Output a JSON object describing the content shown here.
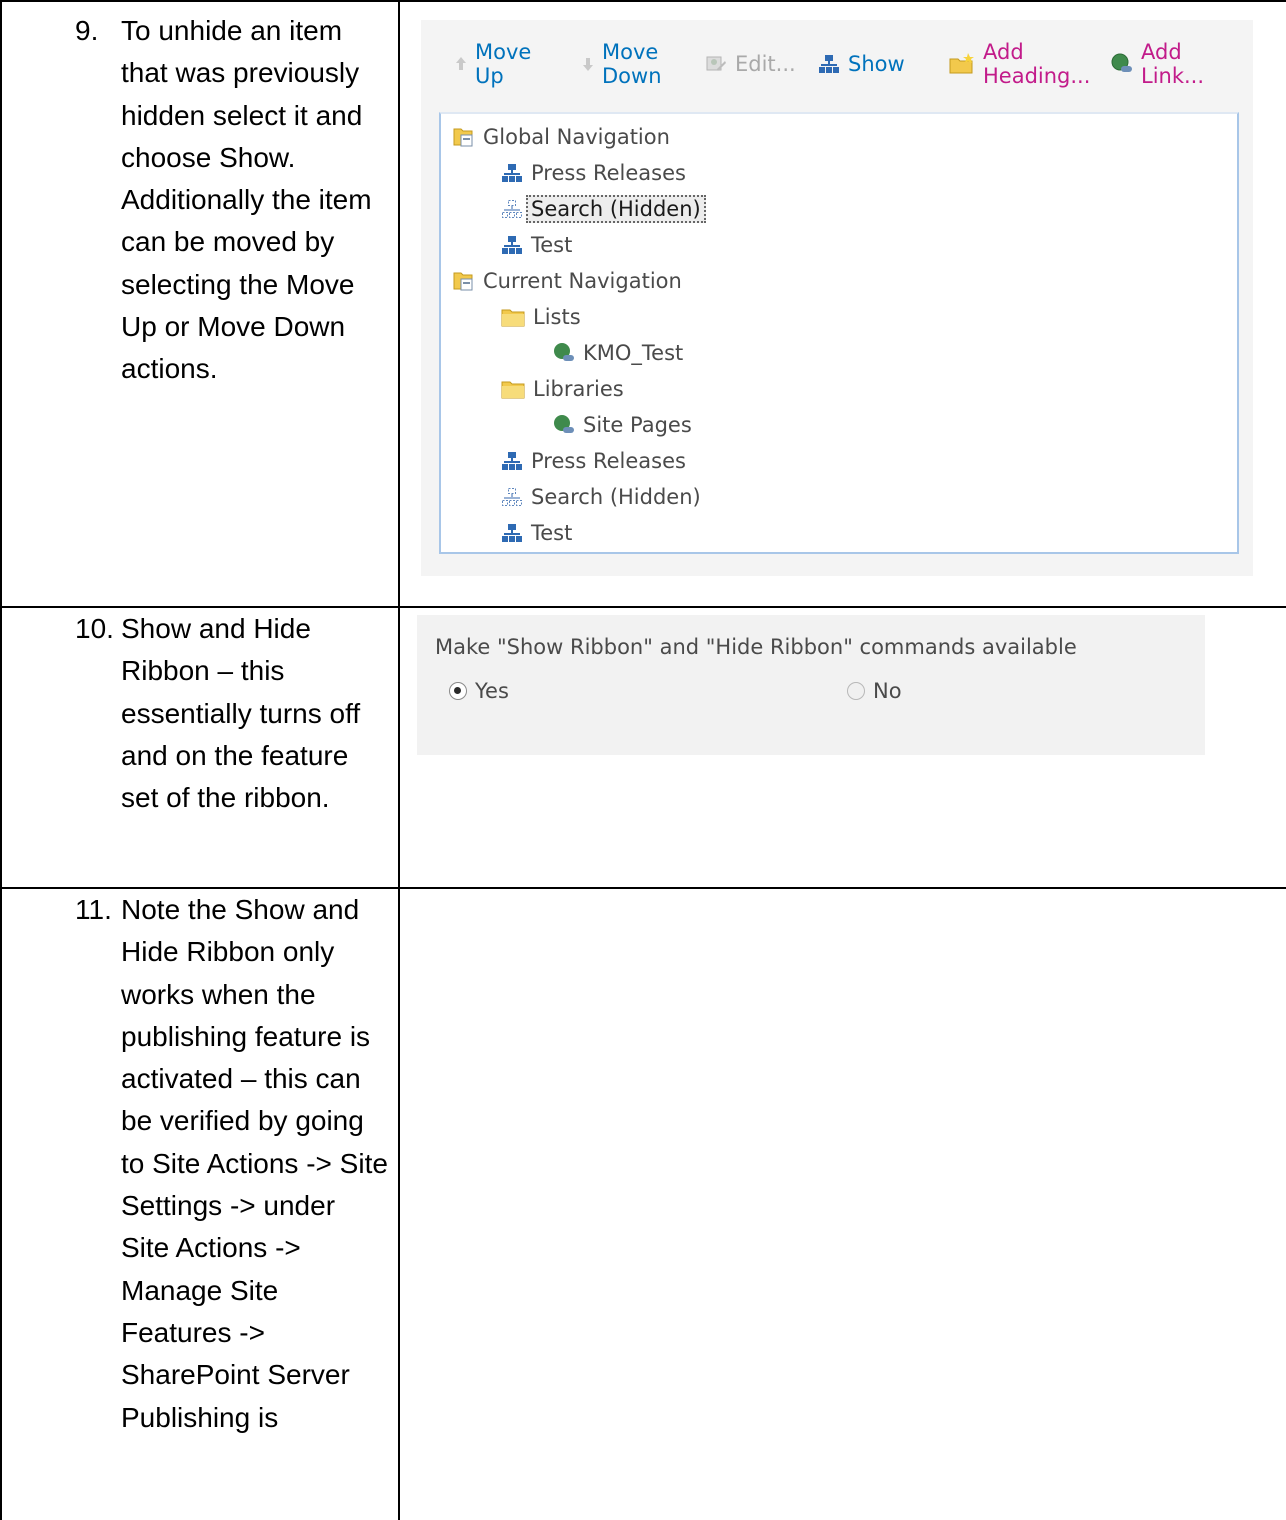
{
  "steps": [
    {
      "number": "9.",
      "text": "To unhide an item that was previously hidden select it and choose Show. Additionally the item can be moved by selecting the Move Up or Move Down actions."
    },
    {
      "number": "10.",
      "text": "Show and Hide Ribbon – this essentially turns off and on the feature set of the ribbon."
    },
    {
      "number": "11.",
      "text": "Note the Show and Hide Ribbon only works when the publishing feature is activated – this can be verified by going to Site Actions -> Site Settings -> under Site Actions -> Manage Site Features -> SharePoint Server Publishing is"
    }
  ],
  "navigation_editor": {
    "toolbar": {
      "move_up": "Move\nUp",
      "move_down": "Move\nDown",
      "edit": "Edit...",
      "show": "Show",
      "add_heading": "Add\nHeading...",
      "add_link": "Add\nLink..."
    },
    "tree": {
      "global_navigation": "Global Navigation",
      "global_press_releases": "Press Releases",
      "global_search": "Search (Hidden)",
      "global_test": "Test",
      "current_navigation": "Current Navigation",
      "lists": "Lists",
      "kmo_test": "KMO_Test",
      "libraries": "Libraries",
      "site_pages": "Site Pages",
      "current_press_releases": "Press Releases",
      "current_search": "Search (Hidden)",
      "current_test": "Test"
    },
    "selected_item": "Search (Hidden)"
  },
  "ribbon_setting": {
    "question": "Make \"Show Ribbon\" and \"Hide Ribbon\" commands available",
    "yes_label": "Yes",
    "no_label": "No",
    "selected": "Yes"
  },
  "icons": {
    "move_up": "up-arrow-icon",
    "move_down": "down-arrow-icon",
    "edit": "edit-icon",
    "show": "sitemap-icon",
    "add_heading": "folder-add-icon",
    "add_link": "link-globe-icon",
    "nav_root": "navigation-root-icon",
    "folder": "folder-icon",
    "page_node": "sitemap-icon",
    "hidden_node": "hidden-sitemap-icon",
    "link_node": "link-globe-icon"
  },
  "colors": {
    "link_blue": "#0072bc",
    "add_magenta": "#c21b8a",
    "disabled_gray": "#a9a9a9",
    "panel_gray": "#f4f4f4",
    "tree_border": "#a8c6e8"
  }
}
